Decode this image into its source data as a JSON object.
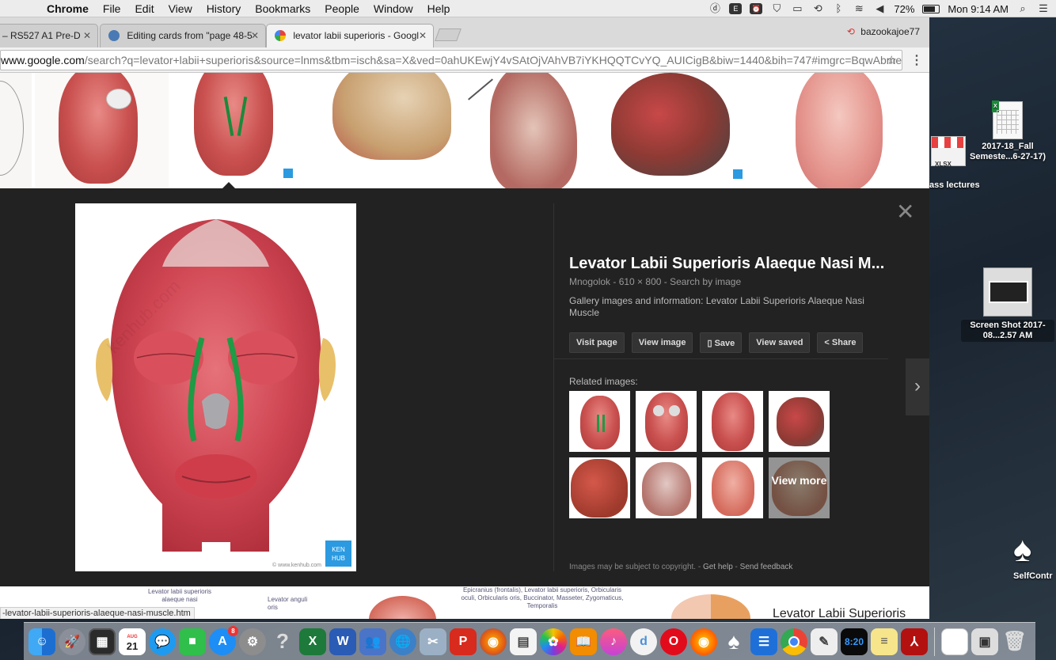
{
  "menubar": {
    "items": [
      "Chrome",
      "File",
      "Edit",
      "View",
      "History",
      "Bookmarks",
      "People",
      "Window",
      "Help"
    ],
    "battery": "72%",
    "clock": "Mon 9:14 AM"
  },
  "tabs": [
    {
      "title": "– RS527 A1 Pre-D"
    },
    {
      "title": "Editing cards from \"page 48-5"
    },
    {
      "title": "levator labii superioris - Googl"
    }
  ],
  "profile_name": "bazookajoe77",
  "address": {
    "host": "www.google.com",
    "path": "/search?q=levator+labii+superioris&source=lnms&tbm=isch&sa=X&ved=0ahUKEwjY4vSAtOjVAhVB7iYKHQQTCvYQ_AUICigB&biw=1440&bih=747#imgrc=BqwAbmeIz..."
  },
  "viewer": {
    "title": "Levator Labii Superioris Alaeque Nasi M...",
    "meta": "Mnogolok  -  610 × 800  -  Search by image",
    "description": "Gallery images and information: Levator Labii Superioris Alaeque Nasi Muscle",
    "buttons": {
      "visit": "Visit page",
      "view": "View image",
      "save": "Save",
      "saved": "View saved",
      "share": "Share"
    },
    "related_title": "Related images:",
    "view_more": "View more",
    "copyright": "Images may be subject to copyright.",
    "get_help": "Get help",
    "send_feedback": "Send feedback",
    "kenhub_badge": "KEN HUB",
    "watermark": "© www.kenhub.com"
  },
  "bottom": {
    "status_url": "-levator-labii-superioris-alaeque-nasi-muscle.htm",
    "caption_a": "Levator labii superioris alaeque nasi",
    "caption_b": "Levator anguli oris",
    "caption_c": "Epicranius (frontalis), Levator labii superioris, Orbicularis oculi, Orbicularis oris, Buccinator, Masseter, Zygomaticus, Temporalis",
    "title_right": "Levator Labii Superioris"
  },
  "desktop": {
    "xlsx_label": "XLSX",
    "folder_label": "ass lectures",
    "file1": "2017-18_Fall Semeste...6-27-17)",
    "screenshot": "Screen Shot 2017-08...2.57 AM",
    "selfcontrol": "SelfContr"
  },
  "dock": {
    "calendar_month": "AUG",
    "calendar_day": "21",
    "appstore_badge": "8",
    "clock_time": "8:20"
  }
}
